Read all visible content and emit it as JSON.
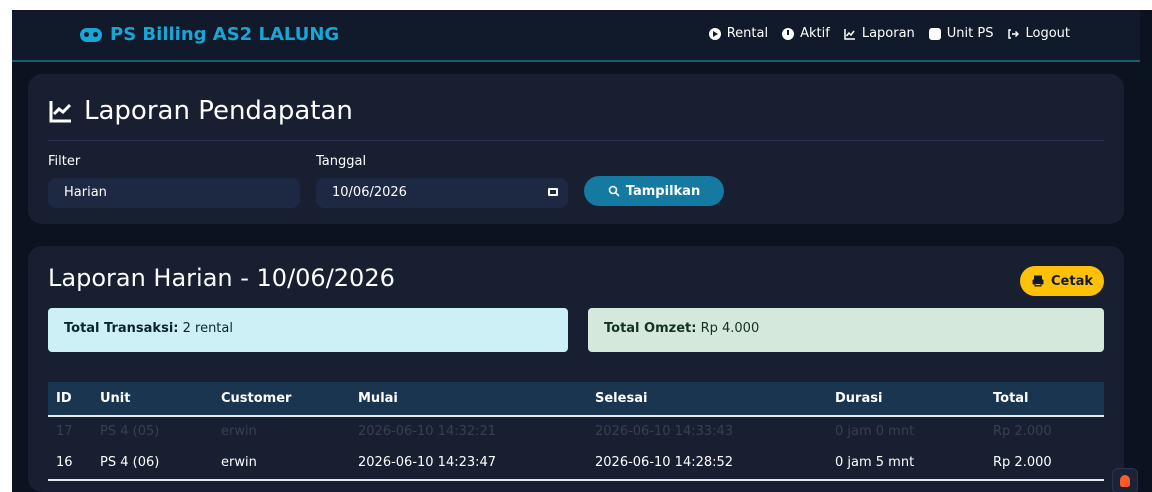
{
  "brand": {
    "title": "PS Billing AS2 LALUNG"
  },
  "nav": [
    {
      "label": "Rental",
      "icon": "play-circle-icon"
    },
    {
      "label": "Aktif",
      "icon": "clock-icon"
    },
    {
      "label": "Laporan",
      "icon": "line-chart-icon"
    },
    {
      "label": "Unit PS",
      "icon": "chip-icon"
    },
    {
      "label": "Logout",
      "icon": "logout-icon"
    }
  ],
  "filter_card": {
    "title": "Laporan Pendapatan",
    "filter_label": "Filter",
    "filter_value": "Harian",
    "date_label": "Tanggal",
    "date_value": "10/06/2026",
    "show_button": "Tampilkan"
  },
  "report": {
    "title": "Laporan Harian - 10/06/2026",
    "print_button": "Cetak",
    "total_transactions_label": "Total Transaksi:",
    "total_transactions_value": "2 rental",
    "total_revenue_label": "Total Omzet:",
    "total_revenue_value": "Rp 4.000"
  },
  "table": {
    "headers": [
      "ID",
      "Unit",
      "Customer",
      "Mulai",
      "Selesai",
      "Durasi",
      "Total"
    ],
    "rows": [
      [
        "17",
        "PS 4 (05)",
        "erwin",
        "2026-06-10 14:32:21",
        "2026-06-10 14:33:43",
        "0 jam 0 mnt",
        "Rp 2.000"
      ],
      [
        "16",
        "PS 4 (06)",
        "erwin",
        "2026-06-10 14:23:47",
        "2026-06-10 14:28:52",
        "0 jam 5 mnt",
        "Rp 2.000"
      ]
    ]
  },
  "colors": {
    "background": "#0b1220",
    "card": "#171f31",
    "brand": "#18a6d6",
    "button_primary": "#157aa2",
    "button_warning": "#ffc107",
    "info_box": "#cdf0f7",
    "success_box": "#d5e8dc"
  }
}
